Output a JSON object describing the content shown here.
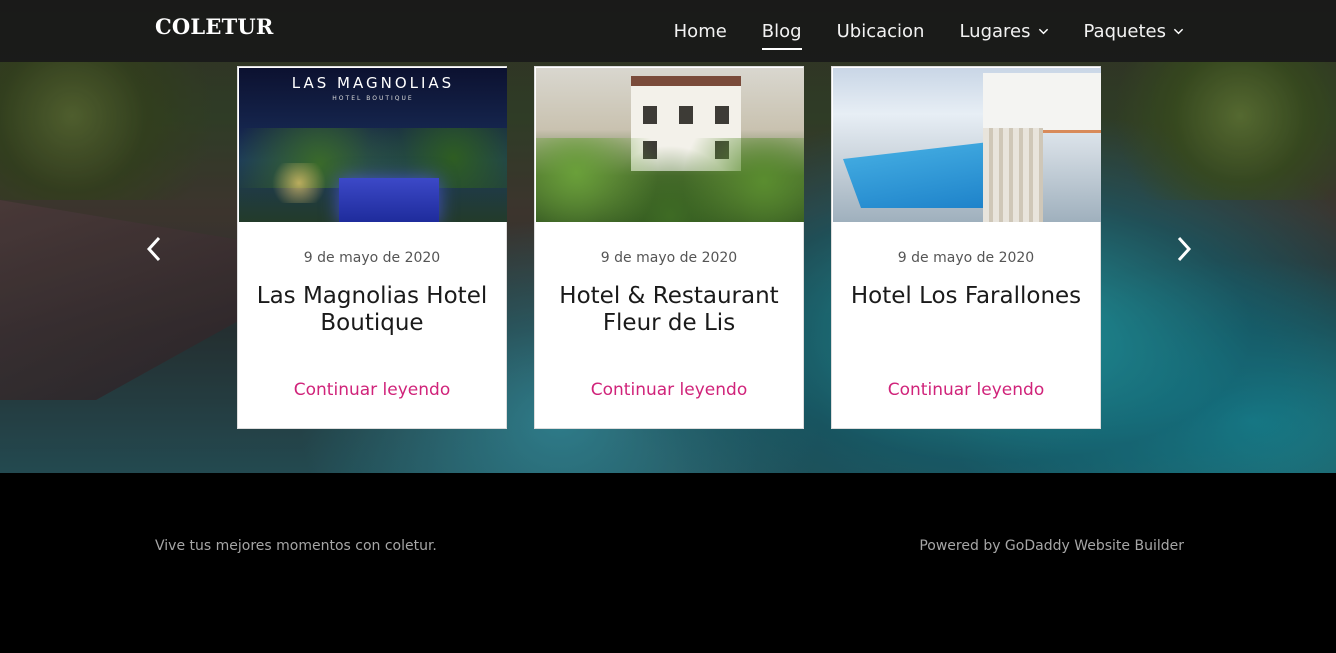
{
  "header": {
    "brand": "COLETUR",
    "nav": [
      {
        "label": "Home",
        "active": false,
        "dropdown": false
      },
      {
        "label": "Blog",
        "active": true,
        "dropdown": false
      },
      {
        "label": "Ubicacion",
        "active": false,
        "dropdown": false
      },
      {
        "label": "Lugares",
        "active": false,
        "dropdown": true
      },
      {
        "label": "Paquetes",
        "active": false,
        "dropdown": true
      }
    ]
  },
  "carousel": {
    "prev_icon": "chevron-left-icon",
    "next_icon": "chevron-right-icon",
    "cards": [
      {
        "image": {
          "logo_line1": "LAS MAGNOLIAS",
          "logo_line2": "HOTEL BOUTIQUE"
        },
        "date": "9 de mayo de 2020",
        "title": "Las Magnolias Hotel Boutique",
        "link": "Continuar leyendo"
      },
      {
        "date": "9 de mayo de 2020",
        "title": "Hotel & Restaurant Fleur de Lis",
        "link": "Continuar leyendo"
      },
      {
        "date": "9 de mayo de 2020",
        "title": "Hotel Los Farallones",
        "link": "Continuar leyendo"
      }
    ]
  },
  "footer": {
    "tagline": "Vive tus mejores momentos con coletur.",
    "powered": "Powered by GoDaddy Website Builder"
  },
  "colors": {
    "header_bg": "#191919",
    "link_accent": "#d0237a",
    "footer_bg": "#000000",
    "footer_text": "#a6a6a6"
  }
}
